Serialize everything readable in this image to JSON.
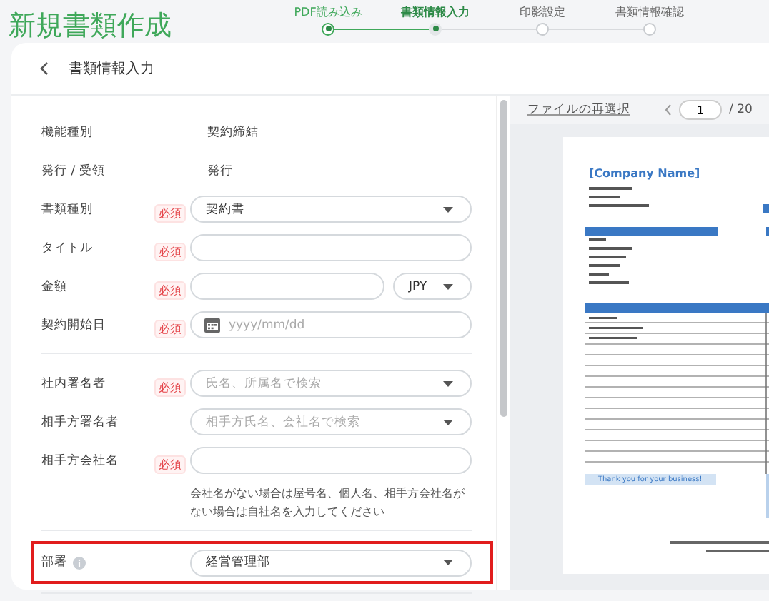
{
  "page_title": "新規書類作成",
  "steps": [
    {
      "label": "PDF読み込み",
      "completed": true,
      "selected": false
    },
    {
      "label": "書類情報入力",
      "completed": false,
      "selected": true
    },
    {
      "label": "印影設定",
      "completed": false,
      "selected": false
    },
    {
      "label": "書類情報確認",
      "completed": false,
      "selected": false
    }
  ],
  "card_title": "書類情報入力",
  "form_sections": [
    [
      {
        "label": "機能種別",
        "kind": "static",
        "value": "契約締結"
      },
      {
        "label": "発行 / 受領",
        "kind": "static",
        "value": "発行"
      },
      {
        "label": "書類種別",
        "kind": "select",
        "badge": "必須",
        "value": "契約書"
      },
      {
        "label": "タイトル",
        "kind": "text",
        "badge": "必須"
      },
      {
        "label": "金額",
        "kind": "amount",
        "badge": "必須",
        "currency": "JPY"
      },
      {
        "label": "契約開始日",
        "kind": "date",
        "badge": "必須",
        "placeholder": "yyyy/mm/dd"
      }
    ],
    [
      {
        "label": "社内署名者",
        "kind": "search",
        "badge": "必須",
        "placeholder": "氏名、所属名で検索"
      },
      {
        "label": "相手方署名者",
        "kind": "search",
        "placeholder": "相手方氏名、会社名で検索"
      },
      {
        "label": "相手方会社名",
        "kind": "text",
        "badge": "必須",
        "hint": "会社名がない場合は屋号名、個人名、相手方会社名がない場合は自社名を入力してください"
      }
    ],
    [
      {
        "label": "部署",
        "kind": "select",
        "info": true,
        "highlighted": true,
        "value": "経営管理部"
      }
    ]
  ],
  "preview": {
    "reselect_link": "ファイルの再選択",
    "page_input": "1",
    "page_total": "/ 20",
    "document": {
      "company_name": "[Company Name]",
      "thank_you": "Thank you for your business!"
    }
  }
}
